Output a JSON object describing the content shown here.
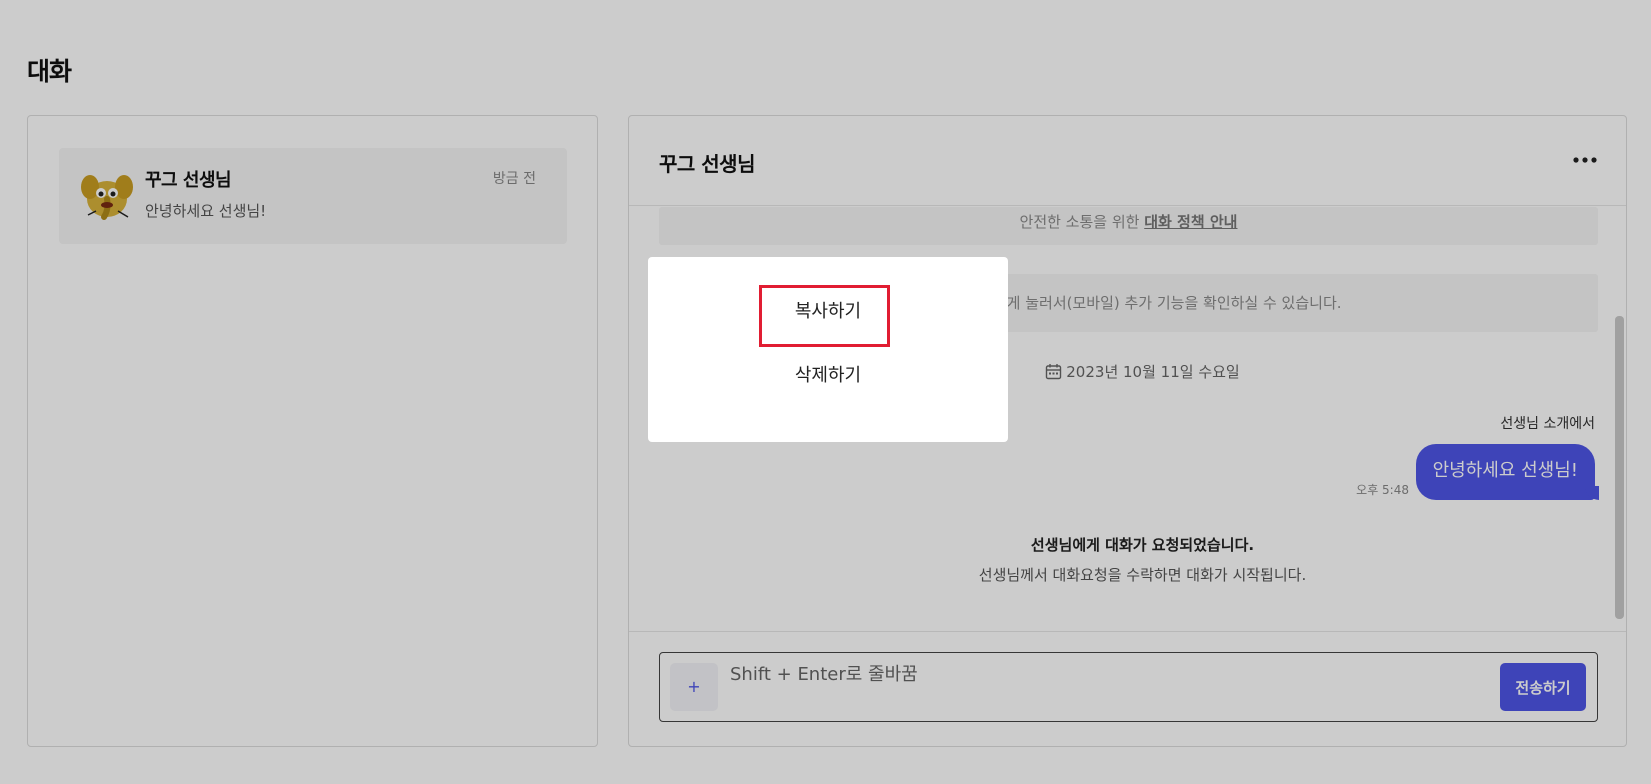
{
  "page": {
    "title": "대화"
  },
  "conversation_list": [
    {
      "name": "꾸그 선생님",
      "time": "방금 전",
      "preview": "안녕하세요 선생님!",
      "avatar_icon": "cartoon-character-avatar"
    }
  ],
  "chat": {
    "header_title": "꾸그 선생님",
    "more_icon": "more-dots-icon",
    "notice_prefix": "안전한 소통을 위한 ",
    "notice_link": "대화 정책 안내",
    "hint_text": "하거나(PC) 길게 눌러서(모바일) 추가 기능을 확인하실 수 있습니다.",
    "date_icon": "calendar-icon",
    "date": "2023년 10월 11일 수요일",
    "message": {
      "source": "선생님 소개에서",
      "text": "안녕하세요 선생님!",
      "time": "오후 5:48"
    },
    "system_title": "선생님에게 대화가 요청되었습니다.",
    "system_sub": "선생님께서 대화요청을 수락하면 대화가 시작됩니다."
  },
  "input": {
    "plus_label": "+",
    "placeholder": "Shift + Enter로 줄바꿈",
    "send_label": "전송하기"
  },
  "context_menu": {
    "copy": "복사하기",
    "delete": "삭제하기"
  },
  "colors": {
    "accent": "#4e55e6",
    "highlight": "#e11d32",
    "overlay": "rgba(0,0,0,0.2)"
  }
}
